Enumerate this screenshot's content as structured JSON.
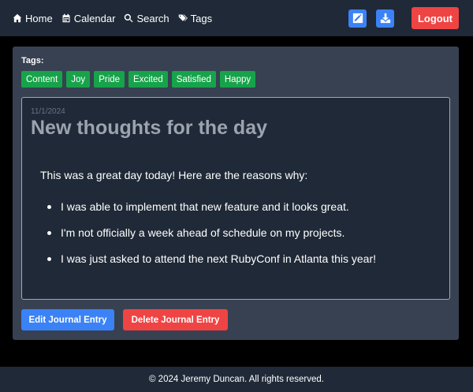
{
  "nav": {
    "links": [
      {
        "label": "Home",
        "icon": "home-icon"
      },
      {
        "label": "Calendar",
        "icon": "calendar-icon"
      },
      {
        "label": "Search",
        "icon": "search-icon"
      },
      {
        "label": "Tags",
        "icon": "tags-icon"
      }
    ],
    "actions": {
      "new_entry_icon": "edit-icon",
      "download_icon": "download-icon",
      "logout_label": "Logout"
    }
  },
  "tags": {
    "label": "Tags:",
    "items": [
      "Content",
      "Joy",
      "Pride",
      "Excited",
      "Satisfied",
      "Happy"
    ]
  },
  "entry": {
    "date": "11/1/2024",
    "title": "New thoughts for the day",
    "intro": "This was a great day today! Here are the reasons why:",
    "bullets": [
      "I was able to implement that new feature and it looks great.",
      "I'm not officially a week ahead of schedule on my projects.",
      "I was just asked to attend the next RubyConf in Atlanta this year!"
    ]
  },
  "buttons": {
    "edit_label": "Edit Journal Entry",
    "delete_label": "Delete Journal Entry"
  },
  "footer": {
    "text": "© 2024 Jeremy Duncan. All rights reserved."
  },
  "colors": {
    "nav_bg": "#1f2937",
    "card_bg": "#374151",
    "entry_bg": "#1f2937",
    "tag_green": "#16a34a",
    "primary_blue": "#3b82f6",
    "danger_red": "#ef4444"
  }
}
